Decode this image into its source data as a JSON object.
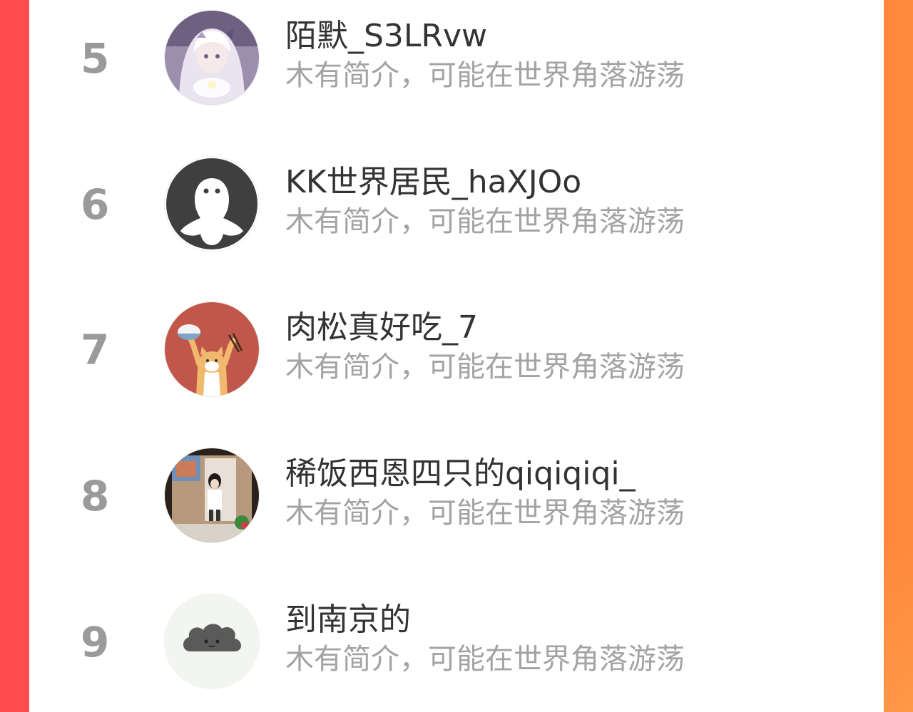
{
  "colors": {
    "background_left": "#ff4a4e",
    "background_right": "#ff8a3e",
    "panel": "#ffffff",
    "rank_text": "#9a9a9a",
    "name_text": "#333333",
    "desc_text": "#a3a3a3"
  },
  "rows": [
    {
      "rank": "5",
      "name": "陌默_S3LRvw",
      "desc": "木有简介，可能在世界角落游荡",
      "avatar_icon": "anime-girl-avatar"
    },
    {
      "rank": "6",
      "name": "KK世界居民_haXJOo",
      "desc": "木有简介，可能在世界角落游荡",
      "avatar_icon": "default-ghost-avatar"
    },
    {
      "rank": "7",
      "name": "肉松真好吃_7",
      "desc": "木有简介，可能在世界角落游荡",
      "avatar_icon": "cat-with-rice-bowl-avatar"
    },
    {
      "rank": "8",
      "name": "稀饭西恩四只的qiqiqiqi_",
      "desc": "木有简介，可能在世界角落游荡",
      "avatar_icon": "mirror-selfie-avatar"
    },
    {
      "rank": "9",
      "name": "到南京的",
      "desc": "木有简介，可能在世界角落游荡",
      "avatar_icon": "gray-cloud-avatar"
    }
  ]
}
